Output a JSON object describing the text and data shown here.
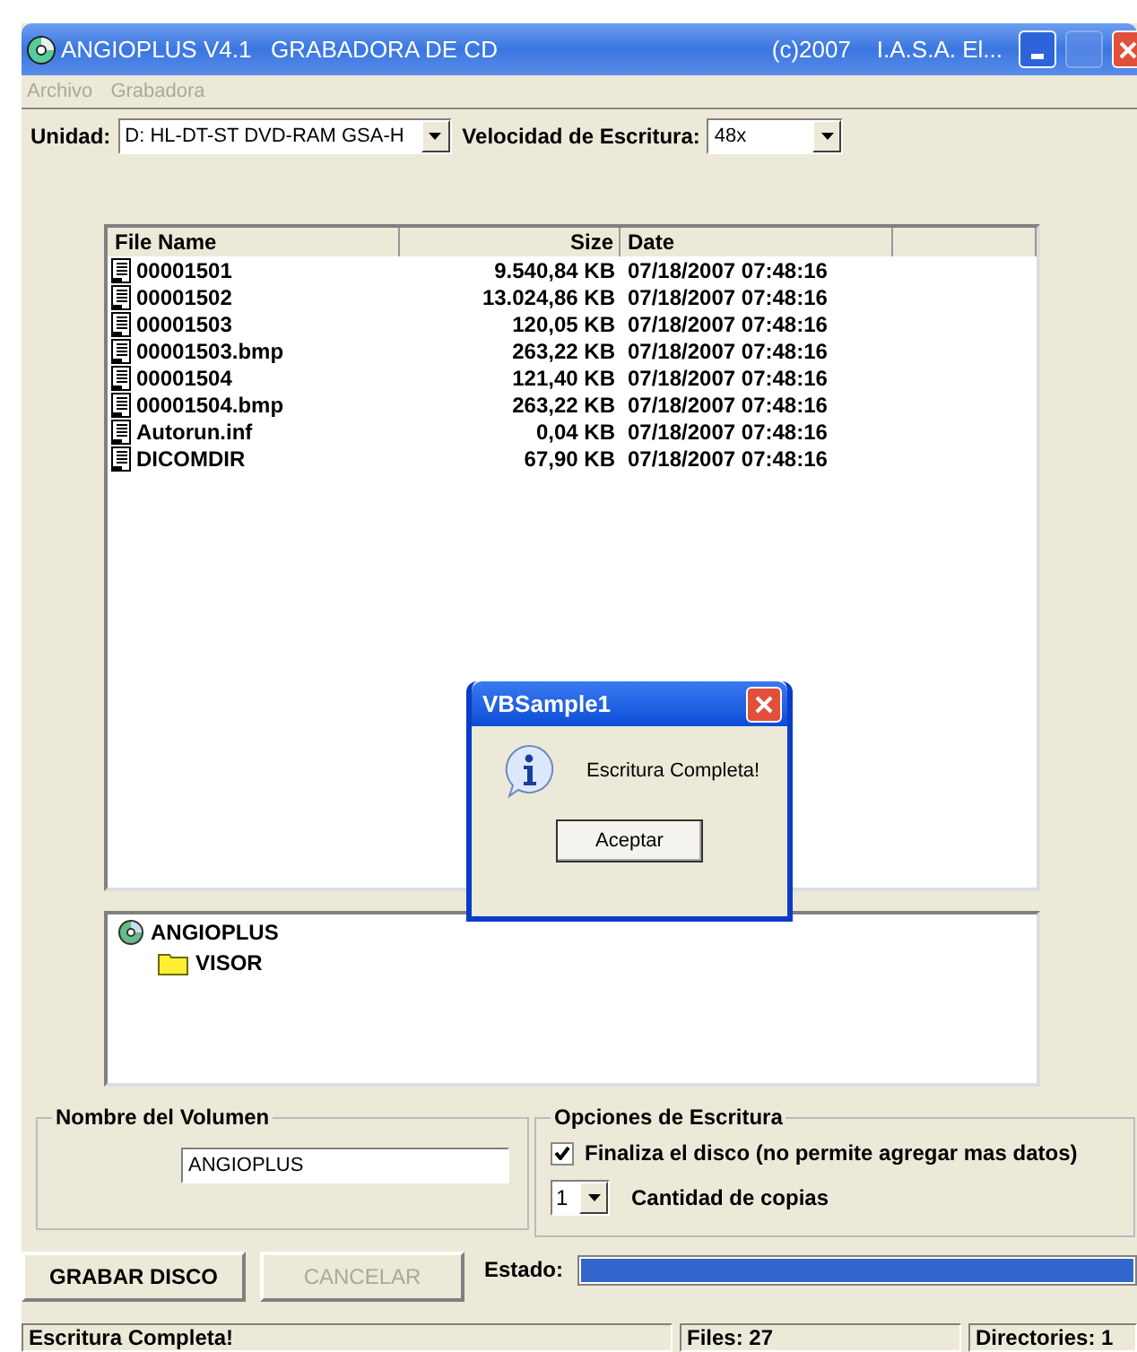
{
  "window": {
    "title": "ANGIOPLUS V4.1   GRABADORA DE CD",
    "title_right": "(c)2007    I.A.S.A. El..."
  },
  "menu": [
    {
      "label": "Archivo",
      "disabled": true
    },
    {
      "label": "Grabadora",
      "disabled": true
    }
  ],
  "drive": {
    "label": "Unidad:",
    "value": "D: HL-DT-ST DVD-RAM GSA-H"
  },
  "speed": {
    "label": "Velocidad de Escritura:",
    "value": "48x"
  },
  "file_list": {
    "columns": [
      "File Name",
      "Size",
      "Date"
    ],
    "rows": [
      [
        "00001501",
        "9.540,84 KB",
        "07/18/2007 07:48:16"
      ],
      [
        "00001502",
        "13.024,86 KB",
        "07/18/2007 07:48:16"
      ],
      [
        "00001503",
        "120,05 KB",
        "07/18/2007 07:48:16"
      ],
      [
        "00001503.bmp",
        "263,22 KB",
        "07/18/2007 07:48:16"
      ],
      [
        "00001504",
        "121,40 KB",
        "07/18/2007 07:48:16"
      ],
      [
        "00001504.bmp",
        "263,22 KB",
        "07/18/2007 07:48:16"
      ],
      [
        "Autorun.inf",
        "0,04 KB",
        "07/18/2007 07:48:16"
      ],
      [
        "DICOMDIR",
        "67,90 KB",
        "07/18/2007 07:48:16"
      ]
    ]
  },
  "tree": [
    {
      "label": "ANGIOPLUS",
      "kind": "disc",
      "children": [
        {
          "label": "VISOR",
          "kind": "folder"
        }
      ]
    }
  ],
  "volume": {
    "legend": "Nombre del Volumen",
    "value": "ANGIOPLUS"
  },
  "options": {
    "legend": "Opciones de Escritura",
    "finalize": {
      "label": "Finaliza el disco (no permite agregar mas datos)",
      "checked": true
    },
    "copies": {
      "value": "1",
      "label": "Cantidad de copias"
    }
  },
  "buttons": [
    {
      "label": "GRABAR DISCO",
      "disabled": false
    },
    {
      "label": "CANCELAR",
      "disabled": true
    }
  ],
  "status": {
    "label": "Estado:",
    "level": 1
  },
  "status_bar": [
    "Escritura Completa!",
    "Files: 27",
    "Directories: 1"
  ],
  "dialog": {
    "title": "VBSample1",
    "message": "Escritura Completa!",
    "button": "Aceptar"
  }
}
